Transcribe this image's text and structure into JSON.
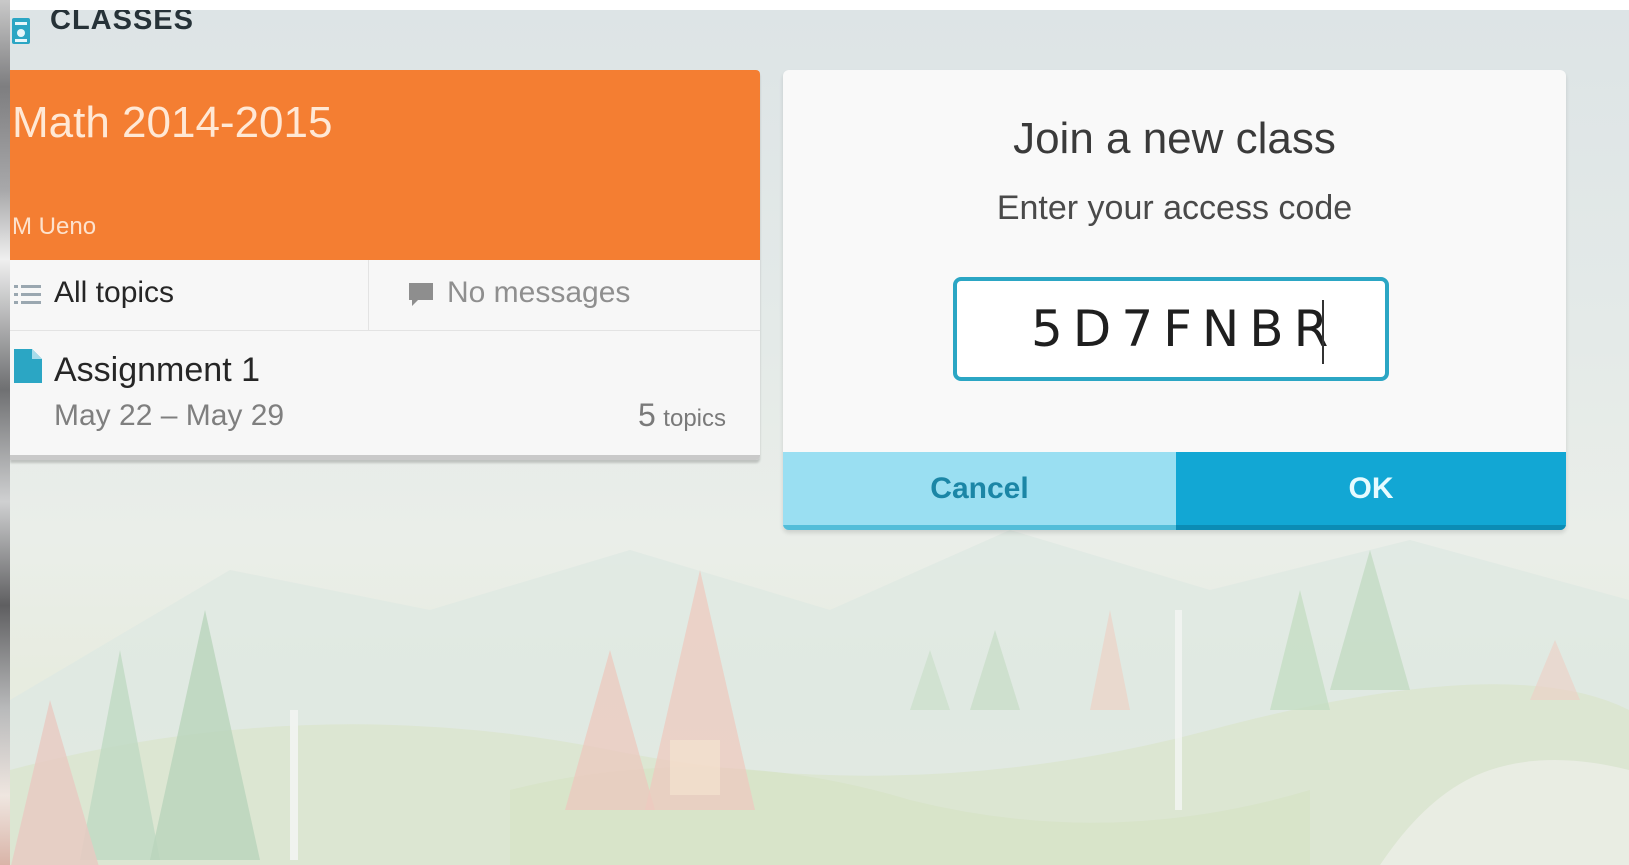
{
  "header": {
    "icon": "classes-icon",
    "title": "CLASSES"
  },
  "class_card": {
    "title": "Math 2014-2015",
    "teacher": "M Ueno",
    "banner_color": "#f47e32",
    "tabs": {
      "all_topics": {
        "icon": "list-icon",
        "label": "All topics"
      },
      "messages": {
        "icon": "message-icon",
        "label": "No messages"
      }
    },
    "assignment": {
      "icon": "document-icon",
      "title": "Assignment 1",
      "dates": "May 22 – May 29",
      "topic_count": "5",
      "topic_unit": "topics"
    }
  },
  "dialog": {
    "title": "Join a new class",
    "subtitle": "Enter your access code",
    "access_code_value": "5D7FNBR",
    "cancel_label": "Cancel",
    "ok_label": "OK",
    "accent_color": "#12a7d4"
  }
}
